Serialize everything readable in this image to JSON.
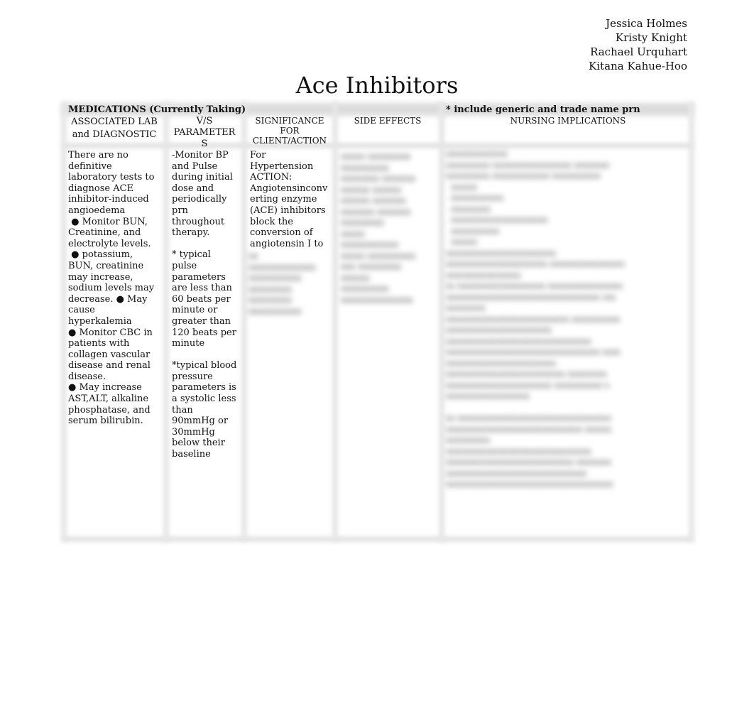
{
  "authors": [
    "Jessica Holmes",
    "Kristy Knight",
    "Rachael Urquhart",
    "Kitana Kahue-Hoo"
  ],
  "title": "Ace Inhibitors",
  "table": {
    "medications_label": "MEDICATIONS (Currently Taking)",
    "medications_note": "* include generic and trade name prn",
    "columns": [
      "ASSOCIATED LAB\nand DIAGNOSTIC",
      "V/S\nPARAMETER\nS",
      "SIGNIFICANCE\nFOR\nCLIENT/ACTION",
      "SIDE EFFECTS",
      "NURSING IMPLICATIONS"
    ],
    "cells": {
      "lab_diagnostic": "There are no\ndefinitive\nlaboratory tests to\ndiagnose ACE\ninhibitor-induced\nangioedema\n ● Monitor BUN,\nCreatinine, and\nelectrolyte levels.\n ● potassium,\nBUN, creatinine\nmay increase,\nsodium levels may\ndecrease. ● May\ncause\nhyperkalemia\n● Monitor CBC in\npatients with\ncollagen vascular\ndisease and renal\ndisease.\n● May increase\nAST,ALT, alkaline\nphosphatase, and\nserum bilirubin.",
      "vs_parameters": "-Monitor BP\nand Pulse\nduring initial\ndose and\nperiodically\nprn\nthroughout\ntherapy.\n\n* typical\npulse\nparameters\nare less than\n60 beats per\nminute or\ngreater than\n120 beats per\nminute\n\n*typical blood\npressure\nparameters is\na systolic less\nthan\n90mmHg or\n30mmHg\nbelow their\nbaseline",
      "significance": "For\nHypertension\nACTION:\nAngiotensinconv\nerting enzyme\n(ACE) inhibitors\nblock the\nconversion of\nangiotensin I to",
      "significance_obscured": "xx\nxxxxxxxxxxxxxx\nxxxxxxxxxxx\nxxxxxxxxx\nxxxxxxxxx\nxxxxxxxxxxx",
      "side_effects_obscured": "xxxxx xxxxxxxxx\nxxxxxxxxxx\nxxxxxxxx xxxxxxx\nxxxxxx xxxxxx\nxxxxxx xxxxxxx\nxxxxxxx xxxxxxx\nxxxxxxxxx\nxxxxx\nxxxxxxxxxxxx\nxxxxx xxxxxxxxxx\nxxx xxxxxxxxx\nxxxxxx\nxxxxxxxxxx\nxxxxxxxxxxxxxxx",
      "nursing_obscured": "xxxxxxxxxxxxxx\nxxxxxxxxxx xxxxxxxxxxxxxxxxxx xxxxxxxx\nxxxxxxxxxx xxxxxxxxxxxxx xxxxxxxxxxx\n  xxxxxx\n  xxxxxxxxxxxx\n  xxxxxxxxx\n  xxxxxxxxxxxxxxxxxxxxxx\n  xxxxxxxxxxx\n  xxxxxx\nxxxxxxxxxxxxxxxxxxxxxxxxx\nxxxxxxxxxxxxxxxxxxxxxxx xxxxxxxxxxxxxxxxx\nxxxxxxxxxxxxxxxxx\nxx xxxxxxxxxxxxxxxxxxxx xxxxxxxxxxxxxxxxx\nxxxxxxxxxxxxxxxxxxxxxxxxxxxxxxxxxxx xxx\nxxxxxxxxx\nxxxxxxxxxxxxxxxxxxxxxxxxxxxx xxxxxxxxxxx\nxxxxxxxxxxxxxxxxxxxxxxxx\nxxxxxxxxxxxxxxxxxxxxxxxxxxxxxxxxx\nxxxxxxxxxxxxxxxxxxxxxxxxxxxxxxxxxxx xxxx\nxxxxxxxxxxxxxxxxxxxxxxxxx\nxxxxxxxxxxxxxxxxxxxxxxxxxxx xxxxxxxxx\nxxxxxxxxxxxxxxxxxxxxxxxx xxxxxxxxxxx x\nxxxxxxxxxxxxxxxxxxx\n\nxx xxxxxxxxxxxxxxxxxxxxxxxxxxxxxxxxxxx\nxxxxxxxxxxxxxxxxxxxxxxxxxxxxxxx xxxxxx\nxxxxxxxxxx\nxxxxxxxxxxxxxxxxxxxxxxxxxxxxxxxxx\nxxxxxxxxxxxxxxxxxxxxxxxxxxxxx xxxxxxxx\nxxxxxxxxxxxxxxxxxxxxxxxxxxxxxxxx\nxxxxxxxxxxxxxxxxxxxxxxxxxxxxxxxxxxxxxx"
    }
  }
}
